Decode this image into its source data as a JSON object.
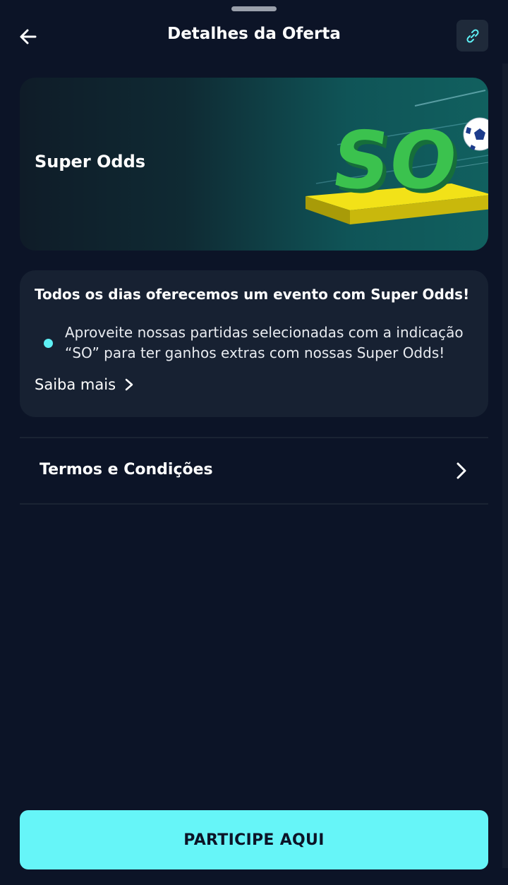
{
  "header": {
    "title": "Detalhes da Oferta",
    "back_icon": "arrow-left-icon",
    "link_icon": "link-icon"
  },
  "banner": {
    "title": "Super Odds",
    "logo_text": "SO"
  },
  "info": {
    "heading": "Todos os dias oferecemos um evento com Super Odds!",
    "bullet": "Aproveite nossas partidas selecionadas com a indicação “SO” para ter ganhos extras com nossas Super Odds!",
    "learn_more": "Saiba mais"
  },
  "terms": {
    "label": "Termos e Condições"
  },
  "cta": {
    "label": "PARTICIPE AQUI"
  },
  "colors": {
    "background": "#0c1427",
    "card": "#172132",
    "accent": "#66f5f8",
    "bullet": "#5ef0f5"
  }
}
